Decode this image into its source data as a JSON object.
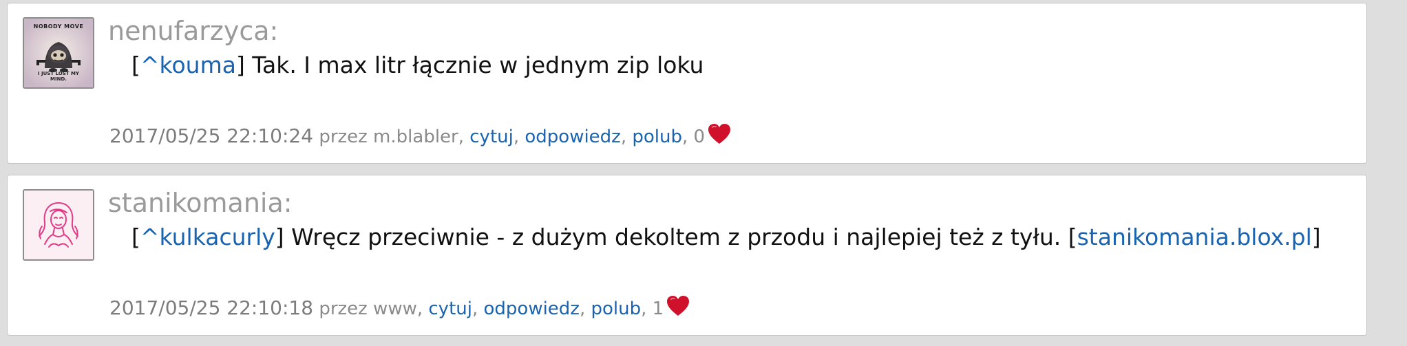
{
  "posts": [
    {
      "username": "nenufarzyca:",
      "avatar_icon": "nobody-move-avatar-icon",
      "avatar_text_top": "NOBODY MOVE",
      "avatar_text_bottom": "I JUST LOST MY MIND.",
      "message": {
        "reply_open": "[",
        "reply_to": "^kouma",
        "reply_close": "]",
        "text": " Tak. I max litr łącznie w jednym zip loku",
        "link_open": "",
        "link": "",
        "link_close": ""
      },
      "timestamp": "2017/05/25 22:10:24",
      "by": "przez m.blabler,",
      "actions": {
        "quote": "cytuj",
        "reply": "odpowiedz",
        "like": "polub"
      },
      "likes": "0"
    },
    {
      "username": "stanikomania:",
      "avatar_icon": "woman-sketch-avatar-icon",
      "message": {
        "reply_open": "[",
        "reply_to": "^kulkacurly",
        "reply_close": "]",
        "text": " Wręcz przeciwnie - z dużym dekoltem z przodu i najlepiej też z tyłu. ",
        "link_open": "[",
        "link": "stanikomania.blox.pl",
        "link_close": "]"
      },
      "timestamp": "2017/05/25 22:10:18",
      "by": "przez www,",
      "actions": {
        "quote": "cytuj",
        "reply": "odpowiedz",
        "like": "polub"
      },
      "likes": "1"
    }
  ],
  "separators": {
    "comma": ",",
    "space": " "
  },
  "colors": {
    "link": "#1a63b0",
    "username": "#9a9a9a",
    "meta": "#8a8a8a",
    "heart": "#d0112b",
    "background": "#dedede"
  },
  "icons": {
    "like": "heart-icon"
  }
}
